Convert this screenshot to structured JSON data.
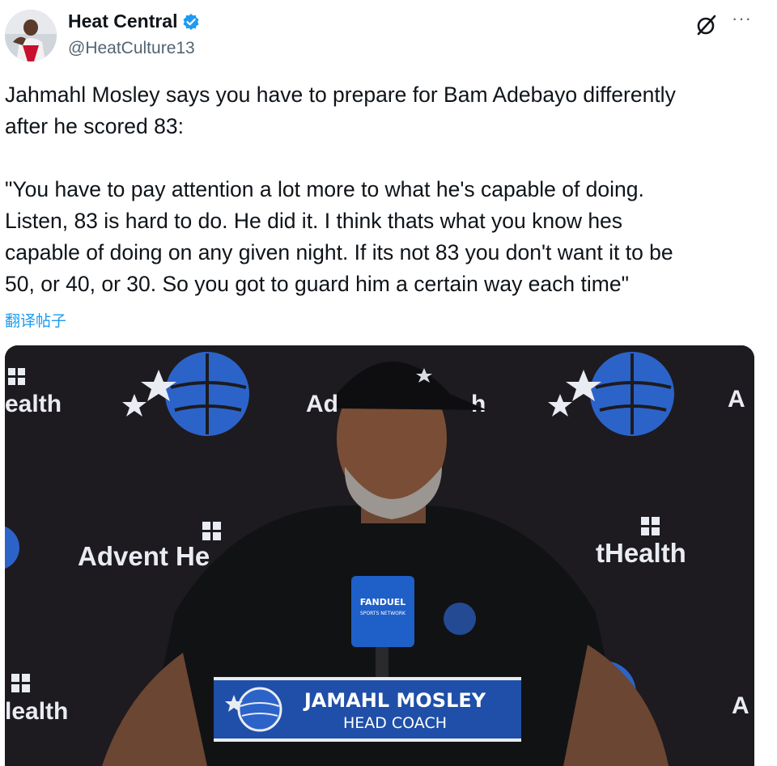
{
  "author": {
    "display_name": "Heat Central",
    "handle": "@HeatCulture13",
    "verified": true,
    "avatar_icon": "avatar-player-photo",
    "verified_icon": "verified-badge-icon"
  },
  "actions": {
    "grok_icon": "grok-icon",
    "more_label": "···"
  },
  "tweet": {
    "text": "Jahmahl Mosley says you have to prepare for Bam Adebayo differently\nafter he scored 83:\n\n\"You have to pay attention a lot more to what he's capable of doing.\nListen, 83 is hard to do. He did it. I think thats what you know hes\ncapable of doing on any given night. If its not 83 you don't want it to be\n50, or 40, or 30. So you got to guard him a certain way each time\"",
    "translate_label": "翻译帖子"
  },
  "media": {
    "backdrop_texts": [
      "ealth",
      "Ad",
      "h",
      "A",
      "Advent He",
      "tHealth",
      "lealth",
      "A"
    ],
    "mic_label": "FANDUEL",
    "mic_sublabel": "SPORTS NETWORK",
    "lower_third": {
      "name": "JAMAHL MOSLEY",
      "title": "HEAD COACH"
    },
    "colors": {
      "backdrop": "#1d1b1f",
      "logo_blue": "#2c63c9",
      "banner_blue": "#1f4fa8"
    }
  }
}
